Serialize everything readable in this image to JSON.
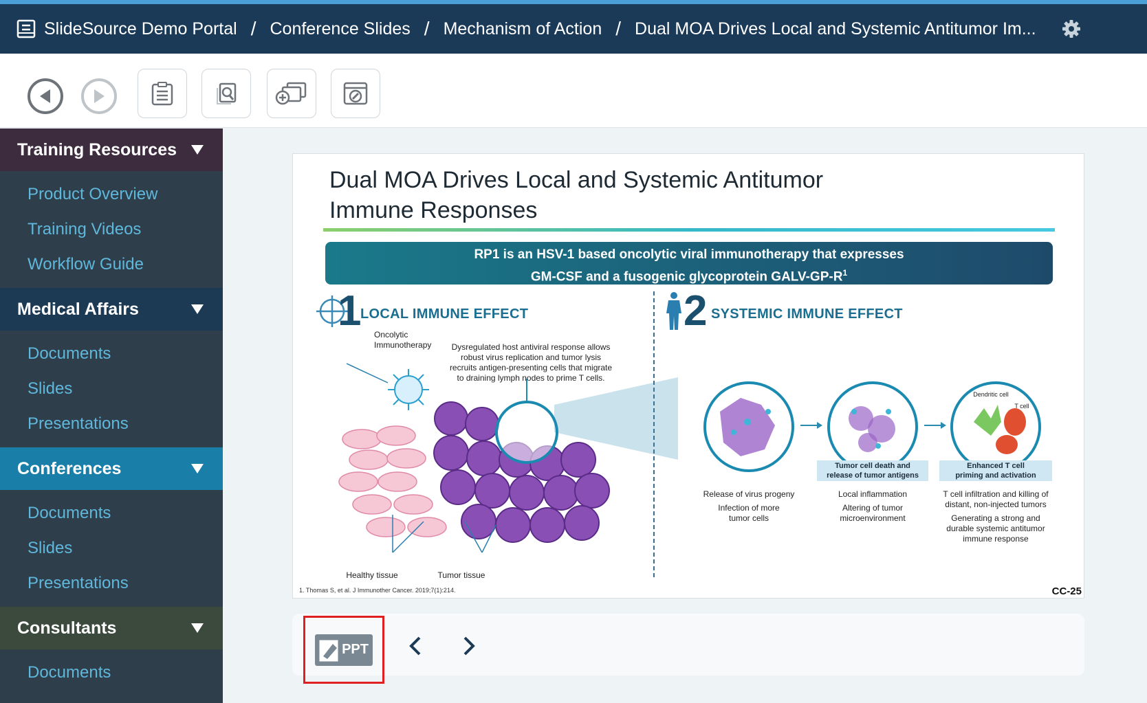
{
  "topbar": {
    "breadcrumbs": [
      "SlideSource Demo Portal",
      "Conference Slides",
      "Mechanism of Action",
      "Dual MOA Drives Local and Systemic Antitumor Im..."
    ],
    "separator": "/"
  },
  "toolbar": {
    "buttons": [
      "back-circle",
      "forward-circle",
      "clipboard-list",
      "search-slides",
      "add-to-deck",
      "edit-slide"
    ]
  },
  "sidebar": {
    "sections": [
      {
        "title": "Training Resources",
        "items": [
          "Product Overview",
          "Training Videos",
          "Workflow Guide"
        ]
      },
      {
        "title": "Medical Affairs",
        "items": [
          "Documents",
          "Slides",
          "Presentations"
        ]
      },
      {
        "title": "Conferences",
        "items": [
          "Documents",
          "Slides",
          "Presentations"
        ]
      },
      {
        "title": "Consultants",
        "items": [
          "Documents"
        ]
      }
    ]
  },
  "slide": {
    "title_line1": "Dual MOA Drives Local and Systemic Antitumor",
    "title_line2": "Immune Responses",
    "banner_line1": "RP1 is an HSV-1 based oncolytic viral immunotherapy that expresses",
    "banner_line2": "GM-CSF and a fusogenic glycoprotein GALV-GP-R",
    "banner_sup": "1",
    "local_num": "1",
    "local_head": "LOCAL IMMUNE EFFECT",
    "systemic_num": "2",
    "systemic_head": "SYSTEMIC IMMUNE EFFECT",
    "oncolytic_label_1": "Oncolytic",
    "oncolytic_label_2": "Immunotherapy",
    "dysreg_1": "Dysregulated host antiviral response allows",
    "dysreg_2": "robust virus replication and tumor lysis",
    "dysreg_3": "recruits antigen-presenting cells that migrate",
    "dysreg_4": "to draining lymph nodes to prime T cells.",
    "healthy_label": "Healthy tissue",
    "tumor_label": "Tumor tissue",
    "band2_1": "Tumor cell death and",
    "band2_2": "release of tumor antigens",
    "band3_1": "Enhanced T cell",
    "band3_2": "priming and activation",
    "dendritic_label": "Dendritic cell",
    "tcell_label": "T cell",
    "col1_a": "Release of virus progeny",
    "col1_b1": "Infection of more",
    "col1_b2": "tumor cells",
    "col2_a": "Local inflammation",
    "col2_b1": "Altering of tumor",
    "col2_b2": "microenvironment",
    "col3_a1": "T cell infiltration and killing of",
    "col3_a2": "distant, non-injected tumors",
    "col3_b1": "Generating a strong and",
    "col3_b2": "durable systemic antitumor",
    "col3_b3": "immune response",
    "footnote": "1. Thomas S, et al. J Immunother Cancer. 2019;7(1):214.",
    "code": "CC-25"
  },
  "controls": {
    "ppt_label": "PPT"
  }
}
